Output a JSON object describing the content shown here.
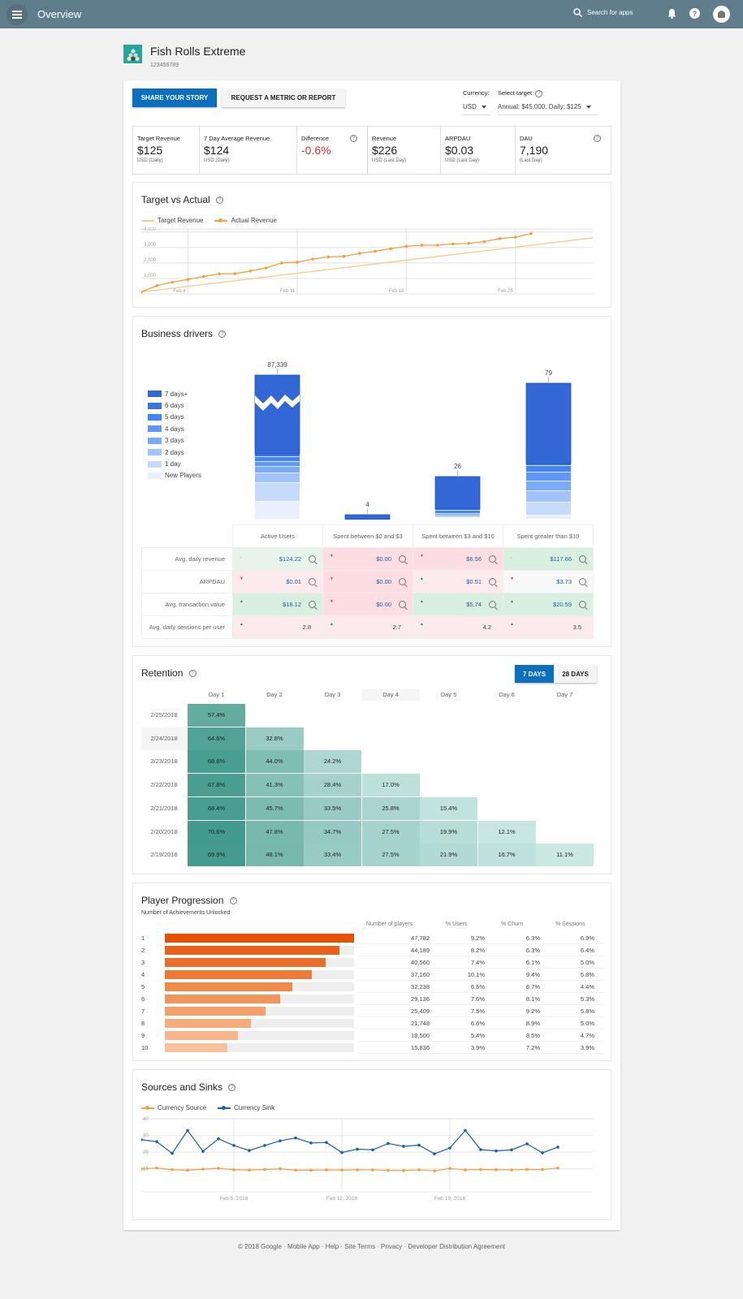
{
  "topbar": {
    "title": "Overview",
    "search_placeholder": "Search for apps",
    "icons": [
      "menu-icon",
      "search-icon",
      "bell-icon",
      "help-icon",
      "account-avatar"
    ]
  },
  "app": {
    "name": "Fish Rolls Extreme",
    "id": "123456789"
  },
  "actions": {
    "share": "SHARE YOUR STORY",
    "request": "REQUEST A METRIC OR REPORT"
  },
  "currency": {
    "label": "Currency:",
    "value": "USD"
  },
  "target": {
    "label": "Select target:",
    "value": "Annual: $45,000, Daily: $125"
  },
  "kpis": [
    {
      "label": "Target Revenue",
      "value": "$125",
      "sub": "USD (Daily)"
    },
    {
      "label": "7 Day Average Revenue",
      "value": "$124",
      "sub": "USD (Daily)"
    },
    {
      "label": "Difference",
      "value": "-0.6%",
      "sub": ""
    },
    {
      "label": "Revenue",
      "value": "$226",
      "sub": "USD (Last Day)"
    },
    {
      "label": "ARPDAU",
      "value": "$0.03",
      "sub": "USD (Last Day)"
    },
    {
      "label": "DAU",
      "value": "7,190",
      "sub": "(Last Day)"
    }
  ],
  "colors": {
    "primary": "#0b6fbd",
    "negative": "#d32f2f",
    "orange": "#f5a13a",
    "blue_sink": "#1a5fa8",
    "teal": "#26a69a"
  },
  "target_vs_actual": {
    "title": "Target vs Actual",
    "chart_data": {
      "type": "line",
      "title": "Target vs Actual",
      "series": [
        {
          "name": "Target Revenue",
          "values": [
            125,
            3625
          ]
        },
        {
          "name": "Actual Revenue",
          "values": [
            124,
            530,
            760,
            940,
            1120,
            1300,
            1310,
            1480,
            1680,
            2000,
            2050,
            2250,
            2390,
            2430,
            2620,
            2760,
            2920,
            3080,
            3150,
            3150,
            3230,
            3270,
            3380,
            3580,
            3670,
            3900
          ]
        }
      ],
      "x_ticks": [
        "Feb 4",
        "Feb 11",
        "Feb 18",
        "Feb 25"
      ],
      "y_ticks": [
        "1,000",
        "2,000",
        "3,000",
        "4,000"
      ],
      "ylim": [
        0,
        4200
      ]
    }
  },
  "business_drivers": {
    "title": "Business drivers",
    "legend": [
      "7 days+",
      "6 days",
      "5 days",
      "4 days",
      "3 days",
      "2 days",
      "1 day",
      "New Players"
    ],
    "chart_data": {
      "type": "bar",
      "stacked": true,
      "categories": [
        "Active Users",
        "Spent between $0 and $3",
        "Spent between $3 and $10",
        "Spent greater than $10"
      ],
      "totals": [
        "87,339",
        "4",
        "26",
        "79"
      ],
      "axis_break_on_first": true
    },
    "columns": [
      "Active Users",
      "Spent between $0 and $3",
      "Spent between $3 and $10",
      "Spent greater than $10"
    ],
    "rows": [
      {
        "label": "Avg. daily revenue",
        "cells": [
          {
            "value": "$124.22",
            "trend": "flat",
            "bg": "#e6f4ea"
          },
          {
            "value": "$0.00",
            "trend": "down",
            "bg": "#fcdde1"
          },
          {
            "value": "$6.56",
            "trend": "down",
            "bg": "#fcdde1"
          },
          {
            "value": "$117.66",
            "trend": "flat",
            "bg": "#d9efdf"
          }
        ]
      },
      {
        "label": "ARPDAU",
        "cells": [
          {
            "value": "$0.01",
            "trend": "down",
            "bg": "#fdeaec"
          },
          {
            "value": "$0.00",
            "trend": "down",
            "bg": "#fcdde1"
          },
          {
            "value": "$0.51",
            "trend": "up",
            "bg": "#fdeaec"
          },
          {
            "value": "$3.73",
            "trend": "down",
            "bg": "#f8f8f8"
          }
        ]
      },
      {
        "label": "Avg. transaction value",
        "cells": [
          {
            "value": "$18.12",
            "trend": "up",
            "bg": "#d9efdf"
          },
          {
            "value": "$0.00",
            "trend": "down",
            "bg": "#fcdde1"
          },
          {
            "value": "$5.74",
            "trend": "up",
            "bg": "#d9efdf"
          },
          {
            "value": "$20.59",
            "trend": "up",
            "bg": "#d9efdf"
          }
        ]
      },
      {
        "label": "Avg. daily sessions per user",
        "cells": [
          {
            "value": "2.8",
            "trend": "up",
            "bg": "#fdeaec"
          },
          {
            "value": "2.7",
            "trend": "up",
            "bg": "#fdeaec"
          },
          {
            "value": "4.2",
            "trend": "up",
            "bg": "#fdeaec"
          },
          {
            "value": "3.5",
            "trend": "up",
            "bg": "#fdeaec"
          }
        ]
      }
    ]
  },
  "retention": {
    "title": "Retention",
    "toggle": [
      "7 DAYS",
      "28 DAYS"
    ],
    "toggle_selected": "7 DAYS",
    "chart_data": {
      "type": "heatmap",
      "columns": [
        "Day 1",
        "Day 2",
        "Day 3",
        "Day 4",
        "Day 5",
        "Day 6",
        "Day 7"
      ],
      "rows": [
        {
          "date": "2/25/2018",
          "values": [
            "57.4%"
          ]
        },
        {
          "date": "2/24/2018",
          "values": [
            "64.6%",
            "32.8%"
          ]
        },
        {
          "date": "2/23/2018",
          "values": [
            "68.6%",
            "44.0%",
            "24.2%"
          ]
        },
        {
          "date": "2/22/2018",
          "values": [
            "67.8%",
            "41.3%",
            "28.4%",
            "17.0%"
          ]
        },
        {
          "date": "2/21/2018",
          "values": [
            "68.4%",
            "45.7%",
            "33.5%",
            "25.8%",
            "15.4%"
          ]
        },
        {
          "date": "2/20/2018",
          "values": [
            "70.6%",
            "47.8%",
            "34.7%",
            "27.5%",
            "19.9%",
            "12.1%"
          ]
        },
        {
          "date": "2/19/2018",
          "values": [
            "69.9%",
            "48.1%",
            "33.4%",
            "27.5%",
            "21.9%",
            "16.7%",
            "11.1%"
          ]
        }
      ]
    }
  },
  "player_progression": {
    "title": "Player Progression",
    "subtitle": "Number of Achievements Unlocked",
    "headers": [
      "Number of players",
      "% Users",
      "% Churn",
      "% Sessions"
    ],
    "chart_data": {
      "type": "bar",
      "orientation": "horizontal",
      "categories": [
        "1",
        "2",
        "3",
        "4",
        "5",
        "6",
        "7",
        "8",
        "9",
        "10"
      ],
      "values": [
        47782,
        44189,
        40560,
        37160,
        32238,
        29136,
        25409,
        21748,
        18500,
        15836
      ]
    },
    "rows": [
      {
        "level": "1",
        "players": "47,782",
        "users": "9.2%",
        "churn": "6.3%",
        "sessions": "6.9%"
      },
      {
        "level": "2",
        "players": "44,189",
        "users": "8.2%",
        "churn": "6.3%",
        "sessions": "6.4%"
      },
      {
        "level": "3",
        "players": "40,560",
        "users": "7.4%",
        "churn": "6.1%",
        "sessions": "5.0%"
      },
      {
        "level": "4",
        "players": "37,160",
        "users": "10.1%",
        "churn": "9.4%",
        "sessions": "5.8%"
      },
      {
        "level": "5",
        "players": "32,238",
        "users": "6.5%",
        "churn": "6.7%",
        "sessions": "4.4%"
      },
      {
        "level": "6",
        "players": "29,136",
        "users": "7.6%",
        "churn": "8.1%",
        "sessions": "5.3%"
      },
      {
        "level": "7",
        "players": "25,409",
        "users": "7.5%",
        "churn": "9.2%",
        "sessions": "5.8%"
      },
      {
        "level": "8",
        "players": "21,748",
        "users": "6.6%",
        "churn": "8.9%",
        "sessions": "5.0%"
      },
      {
        "level": "9",
        "players": "18,500",
        "users": "5.4%",
        "churn": "8.5%",
        "sessions": "4.7%"
      },
      {
        "level": "10",
        "players": "15,836",
        "users": "3.9%",
        "churn": "7.2%",
        "sessions": "3.9%"
      }
    ]
  },
  "sources_sinks": {
    "title": "Sources and Sinks",
    "chart_data": {
      "type": "line",
      "series": [
        {
          "name": "Currency Source",
          "values": [
            10,
            10.5,
            9.5,
            9.2,
            9.8,
            10.3,
            9.5,
            9.3,
            9.6,
            10,
            9.2,
            9.2,
            9.4,
            9.3,
            9.4,
            9.4,
            9.1,
            9.0,
            9.4,
            8.8,
            10.2,
            9.4,
            9.6,
            9.5,
            9.4,
            9.6,
            9.6,
            10.5
          ]
        },
        {
          "name": "Currency Sink",
          "values": [
            27.5,
            26.3,
            19.3,
            33,
            20.5,
            28,
            24,
            21,
            24,
            26.8,
            28.5,
            25.5,
            25.8,
            19.8,
            21.8,
            21.4,
            25.2,
            23.5,
            24.2,
            19,
            22.5,
            33,
            21.5,
            20.8,
            21.4,
            25,
            19.6,
            23
          ]
        }
      ],
      "x_ticks": [
        "Feb 5, 2018",
        "Feb 12, 2018",
        "Feb 19, 2018"
      ],
      "y_ticks": [
        "10",
        "20",
        "30",
        "40"
      ],
      "ylim": [
        5,
        40
      ]
    }
  },
  "footer": "© 2018 Google · Mobile App · Help · Site Terms · Privacy · Developer Distribution Agreement"
}
